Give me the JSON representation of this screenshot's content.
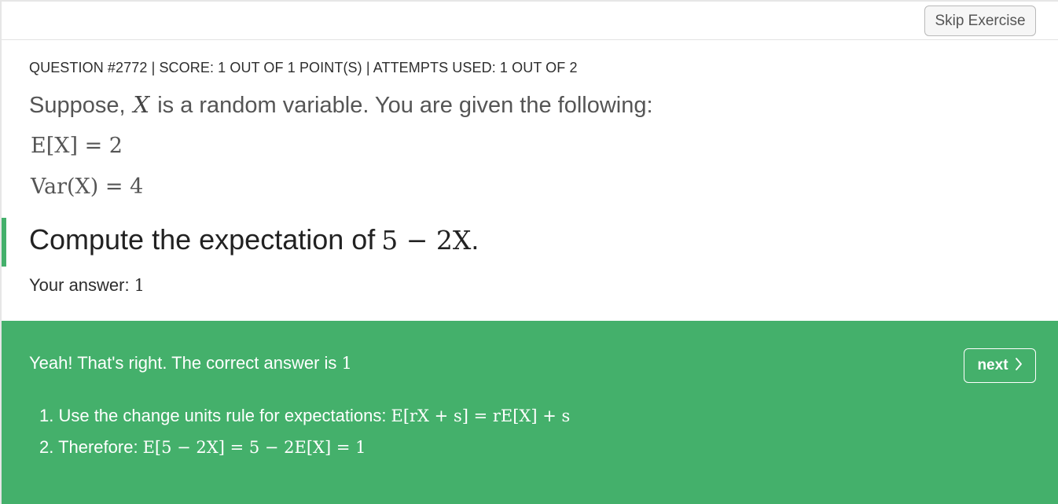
{
  "toolbar": {
    "skip_label": "Skip Exercise"
  },
  "meta": "QUESTION #2772 | SCORE: 1 OUT OF 1 POINT(S) |  ATTEMPTS USED: 1 OUT OF 2",
  "prompt": {
    "before": "Suppose,",
    "variable": "X",
    "after": "is a random variable. You are given the following:"
  },
  "given": [
    {
      "label": "E[X] = 2"
    },
    {
      "label": "Var(X) = 4"
    }
  ],
  "question": {
    "text": "Compute the expectation of",
    "expr": "5 − 2X",
    "end": "."
  },
  "your_answer": {
    "label": "Your answer:",
    "value": "1"
  },
  "feedback": {
    "message": "Yeah! That's right. The correct answer is",
    "correct_value": "1",
    "next_label": "next",
    "steps": [
      {
        "text": "1. Use the change units rule for expectations:",
        "math": "E[rX + s] = rE[X] + s"
      },
      {
        "text": "2. Therefore:",
        "math": "E[5 − 2X] = 5 − 2E[X] = 1"
      }
    ]
  },
  "colors": {
    "accent": "#44b06b",
    "text": "#333333",
    "button_border": "#b9b9b9"
  },
  "icons": {
    "next": "chevron-right-icon"
  }
}
